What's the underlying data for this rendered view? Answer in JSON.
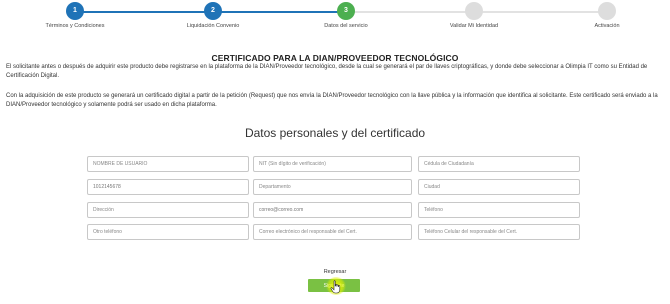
{
  "stepper": {
    "steps": [
      {
        "number": "1",
        "label": "Términos y Condiciones",
        "status": "complete",
        "color": "#1f73b7"
      },
      {
        "number": "2",
        "label": "Liquidación Convenio",
        "status": "complete",
        "color": "#1f73b7"
      },
      {
        "number": "3",
        "label": "Datos del servicio",
        "status": "active",
        "color": "#4caf50"
      },
      {
        "number": "",
        "label": "Validar Mi Identidad",
        "status": "pending",
        "color": "#dddddd"
      },
      {
        "number": "",
        "label": "Activación",
        "status": "pending",
        "color": "#dddddd"
      }
    ]
  },
  "content": {
    "title": "CERTIFICADO PARA LA DIAN/PROVEEDOR TECNOLÓGICO",
    "paragraph1": "El solicitante antes o después de adquirir este producto debe registrarse en la plataforma de la DIAN/Proveedor tecnológico, desde la cual se generará el par de llaves criptográficas, y donde debe seleccionar a Olimpia IT como su Entidad de Certificación Digital.",
    "paragraph2": "Con la adquisición de este producto se generará un certificado digital a partir de la petición (Request) que nos envía la DIAN/Proveedor tecnológico con la llave pública y la información que identifica al solicitante. Este certificado será enviado a la DIAN/Proveedor tecnológico y solamente podrá ser usado en dicha plataforma.",
    "form_title": "Datos personales y del certificado"
  },
  "form": {
    "nombre_usuario": {
      "placeholder": "NOMBRE DE USUARIO",
      "value": ""
    },
    "nit": {
      "placeholder": "NIT (Sin dígito de verificación)",
      "value": ""
    },
    "cedula": {
      "placeholder": "Cédula de Ciudadanía",
      "value": ""
    },
    "numero": {
      "placeholder": "",
      "value": "1012145678"
    },
    "departamento": {
      "placeholder": "Departamento",
      "value": ""
    },
    "ciudad": {
      "placeholder": "Ciudad",
      "value": ""
    },
    "direccion": {
      "placeholder": "Dirección",
      "value": ""
    },
    "correo": {
      "placeholder": "",
      "value": "correo@correo.com"
    },
    "telefono": {
      "placeholder": "Teléfono",
      "value": ""
    },
    "otro_telefono": {
      "placeholder": "Otro teléfono",
      "value": ""
    },
    "correo_responsable": {
      "placeholder": "Correo electrónico del responsable del Cert.",
      "value": ""
    },
    "celular_responsable": {
      "placeholder": "Teléfono Celular del responsable del Cert.",
      "value": ""
    }
  },
  "actions": {
    "back_label": "Regresar",
    "next_label": "Siguiente",
    "next_color": "#7ac143"
  },
  "icons": {
    "cursor": "hand-pointer-icon"
  }
}
